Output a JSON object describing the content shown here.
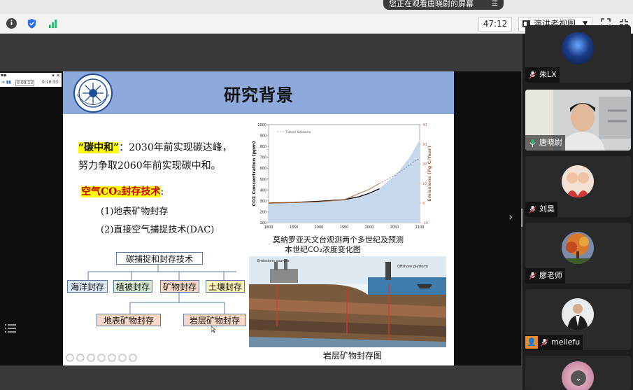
{
  "banner": {
    "share_text": "您正在观看唐晓尉的屏幕",
    "menu_icon": "sharing-menu-icon"
  },
  "toolbar": {
    "timer": "47:12",
    "view_label": "演讲者视图",
    "icons": [
      "info-icon",
      "shield-icon",
      "signal-icon",
      "view-layout-icon",
      "chevron-down-icon",
      "fullscreen-icon",
      "exit-fullscreen-icon"
    ]
  },
  "mini_player": {
    "time_current": "0:00:13",
    "time_total": "0:10:33"
  },
  "slide": {
    "title": "研究背景",
    "carbon_term": "“碳中和”",
    "carbon_line1": "：2030年前实现碳达峰，",
    "carbon_line2": "努力争取2060年前实现碳中和。",
    "tech_term": "空气CO₂封存技术",
    "tech_colon": ":",
    "item1": "(1)地表矿物封存",
    "item2": "(2)直接空气捕捉技术(DAC)",
    "tree": {
      "root": "碳捕捉和封存技术",
      "level1": [
        "海洋封存",
        "植被封存",
        "矿物封存",
        "土壤封存"
      ],
      "level2": [
        "地表矿物封存",
        "岩层矿物封存"
      ]
    },
    "chart_caption1": "莫纳罗亚天文台观测两个多世纪及预测",
    "chart_caption2": "本世纪CO₂浓度变化图",
    "diagram_caption": "岩层矿物封存图"
  },
  "chart_data": {
    "type": "area",
    "xlabel": "",
    "ylabel": "CO2 Concentration (ppm)",
    "y2label": "Emissions (Pg C/Year)",
    "xlim": [
      1800,
      2100
    ],
    "ylim": [
      100,
      1000
    ],
    "y2lim": [
      -10,
      40
    ],
    "x_ticks": [
      1800,
      1850,
      1900,
      1950,
      2000,
      2050,
      2100
    ],
    "y_ticks": [
      100,
      200,
      300,
      400,
      500,
      600,
      700,
      800,
      900,
      1000
    ],
    "y2_ticks": [
      -10,
      0,
      10,
      20,
      30,
      40
    ],
    "legend": [
      "Future Scenario"
    ],
    "series": [
      {
        "name": "CO2 concentration (ppm)",
        "x": [
          1800,
          1850,
          1900,
          1950,
          1980,
          2000,
          2020
        ],
        "y": [
          280,
          285,
          296,
          311,
          339,
          370,
          412
        ]
      },
      {
        "name": "Future Scenario",
        "x": [
          2020,
          2040,
          2060,
          2080,
          2100
        ],
        "y": [
          412,
          490,
          580,
          700,
          860
        ]
      },
      {
        "name": "Emissions (Pg C/Year)",
        "x": [
          1800,
          1850,
          1900,
          1950,
          2000,
          2020,
          2050,
          2100
        ],
        "y": [
          0,
          0.2,
          0.6,
          1.7,
          7,
          10,
          14,
          23
        ]
      }
    ]
  },
  "participants": [
    {
      "name": "朱LX",
      "avatar": "night-sky-avatar",
      "mic": "mic-muted-icon"
    },
    {
      "name": "唐晓尉",
      "avatar": "camera-video",
      "mic": "mic-active-icon",
      "active": true
    },
    {
      "name": "刘昊",
      "avatar": "kids-photo-avatar",
      "mic": "mic-muted-icon"
    },
    {
      "name": "廖老师",
      "avatar": "autumn-tree-avatar",
      "mic": "mic-muted-icon"
    },
    {
      "name": "meilefu",
      "avatar": "man-suit-avatar",
      "mic": "mic-muted-icon"
    }
  ],
  "colors": {
    "slide_header": "#8ea9db",
    "highlight": "#ffff00",
    "tech_text": "#c00000",
    "active_speaker": "#2bb673"
  }
}
